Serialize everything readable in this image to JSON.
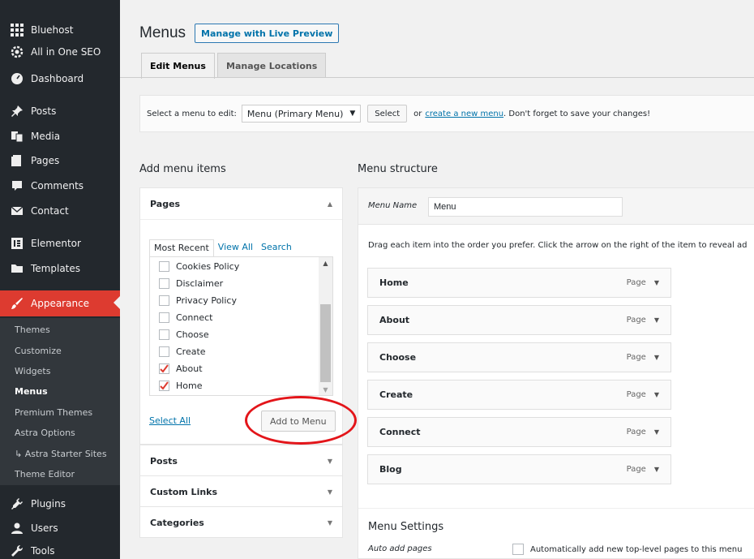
{
  "sidebar": {
    "items": [
      {
        "label": "Bluehost",
        "icon": "grid-icon"
      },
      {
        "label": "All in One SEO",
        "icon": "gear-icon"
      },
      {
        "label": "Dashboard",
        "icon": "gauge-icon"
      },
      {
        "label": "Posts",
        "icon": "pin-icon"
      },
      {
        "label": "Media",
        "icon": "media-icon"
      },
      {
        "label": "Pages",
        "icon": "page-icon"
      },
      {
        "label": "Comments",
        "icon": "comment-icon"
      },
      {
        "label": "Contact",
        "icon": "mail-icon"
      },
      {
        "label": "Elementor",
        "icon": "elementor-icon"
      },
      {
        "label": "Templates",
        "icon": "folder-icon"
      },
      {
        "label": "Appearance",
        "icon": "brush-icon"
      },
      {
        "label": "Plugins",
        "icon": "plug-icon"
      },
      {
        "label": "Users",
        "icon": "user-icon"
      },
      {
        "label": "Tools",
        "icon": "wrench-icon"
      }
    ],
    "submenu": [
      "Themes",
      "Customize",
      "Widgets",
      "Menus",
      "Premium Themes",
      "Astra Options",
      "↳ Astra Starter Sites",
      "Theme Editor"
    ],
    "active_color": "#dd3b30"
  },
  "header": {
    "title": "Menus",
    "preview_button": "Manage with Live Preview"
  },
  "tabs": [
    "Edit Menus",
    "Manage Locations"
  ],
  "select_bar": {
    "prompt": "Select a menu to edit:",
    "selected": "Menu (Primary Menu)",
    "select_button": "Select",
    "or_text": "or",
    "create_link": "create a new menu",
    "reminder": ". Don't forget to save your changes!"
  },
  "add_items": {
    "title": "Add menu items",
    "pages_header": "Pages",
    "mini_tabs": [
      "Most Recent",
      "View All",
      "Search"
    ],
    "pages": [
      {
        "label": "Cookies Policy",
        "checked": false
      },
      {
        "label": "Disclaimer",
        "checked": false
      },
      {
        "label": "Privacy Policy",
        "checked": false
      },
      {
        "label": "Connect",
        "checked": false
      },
      {
        "label": "Choose",
        "checked": false
      },
      {
        "label": "Create",
        "checked": false
      },
      {
        "label": "About",
        "checked": true
      },
      {
        "label": "Home",
        "checked": true
      }
    ],
    "select_all": "Select All",
    "add_button": "Add to Menu",
    "other_sections": [
      "Posts",
      "Custom Links",
      "Categories"
    ]
  },
  "structure": {
    "title": "Menu structure",
    "name_label": "Menu Name",
    "name_value": "Menu",
    "help": "Drag each item into the order you prefer. Click the arrow on the right of the item to reveal ad",
    "items": [
      {
        "label": "Home",
        "type": "Page"
      },
      {
        "label": "About",
        "type": "Page"
      },
      {
        "label": "Choose",
        "type": "Page"
      },
      {
        "label": "Create",
        "type": "Page"
      },
      {
        "label": "Connect",
        "type": "Page"
      },
      {
        "label": "Blog",
        "type": "Page"
      }
    ],
    "settings_title": "Menu Settings",
    "auto_add_label": "Auto add pages",
    "auto_add_text": "Automatically add new top-level pages to this menu"
  },
  "annotation_color": "#e3151a"
}
